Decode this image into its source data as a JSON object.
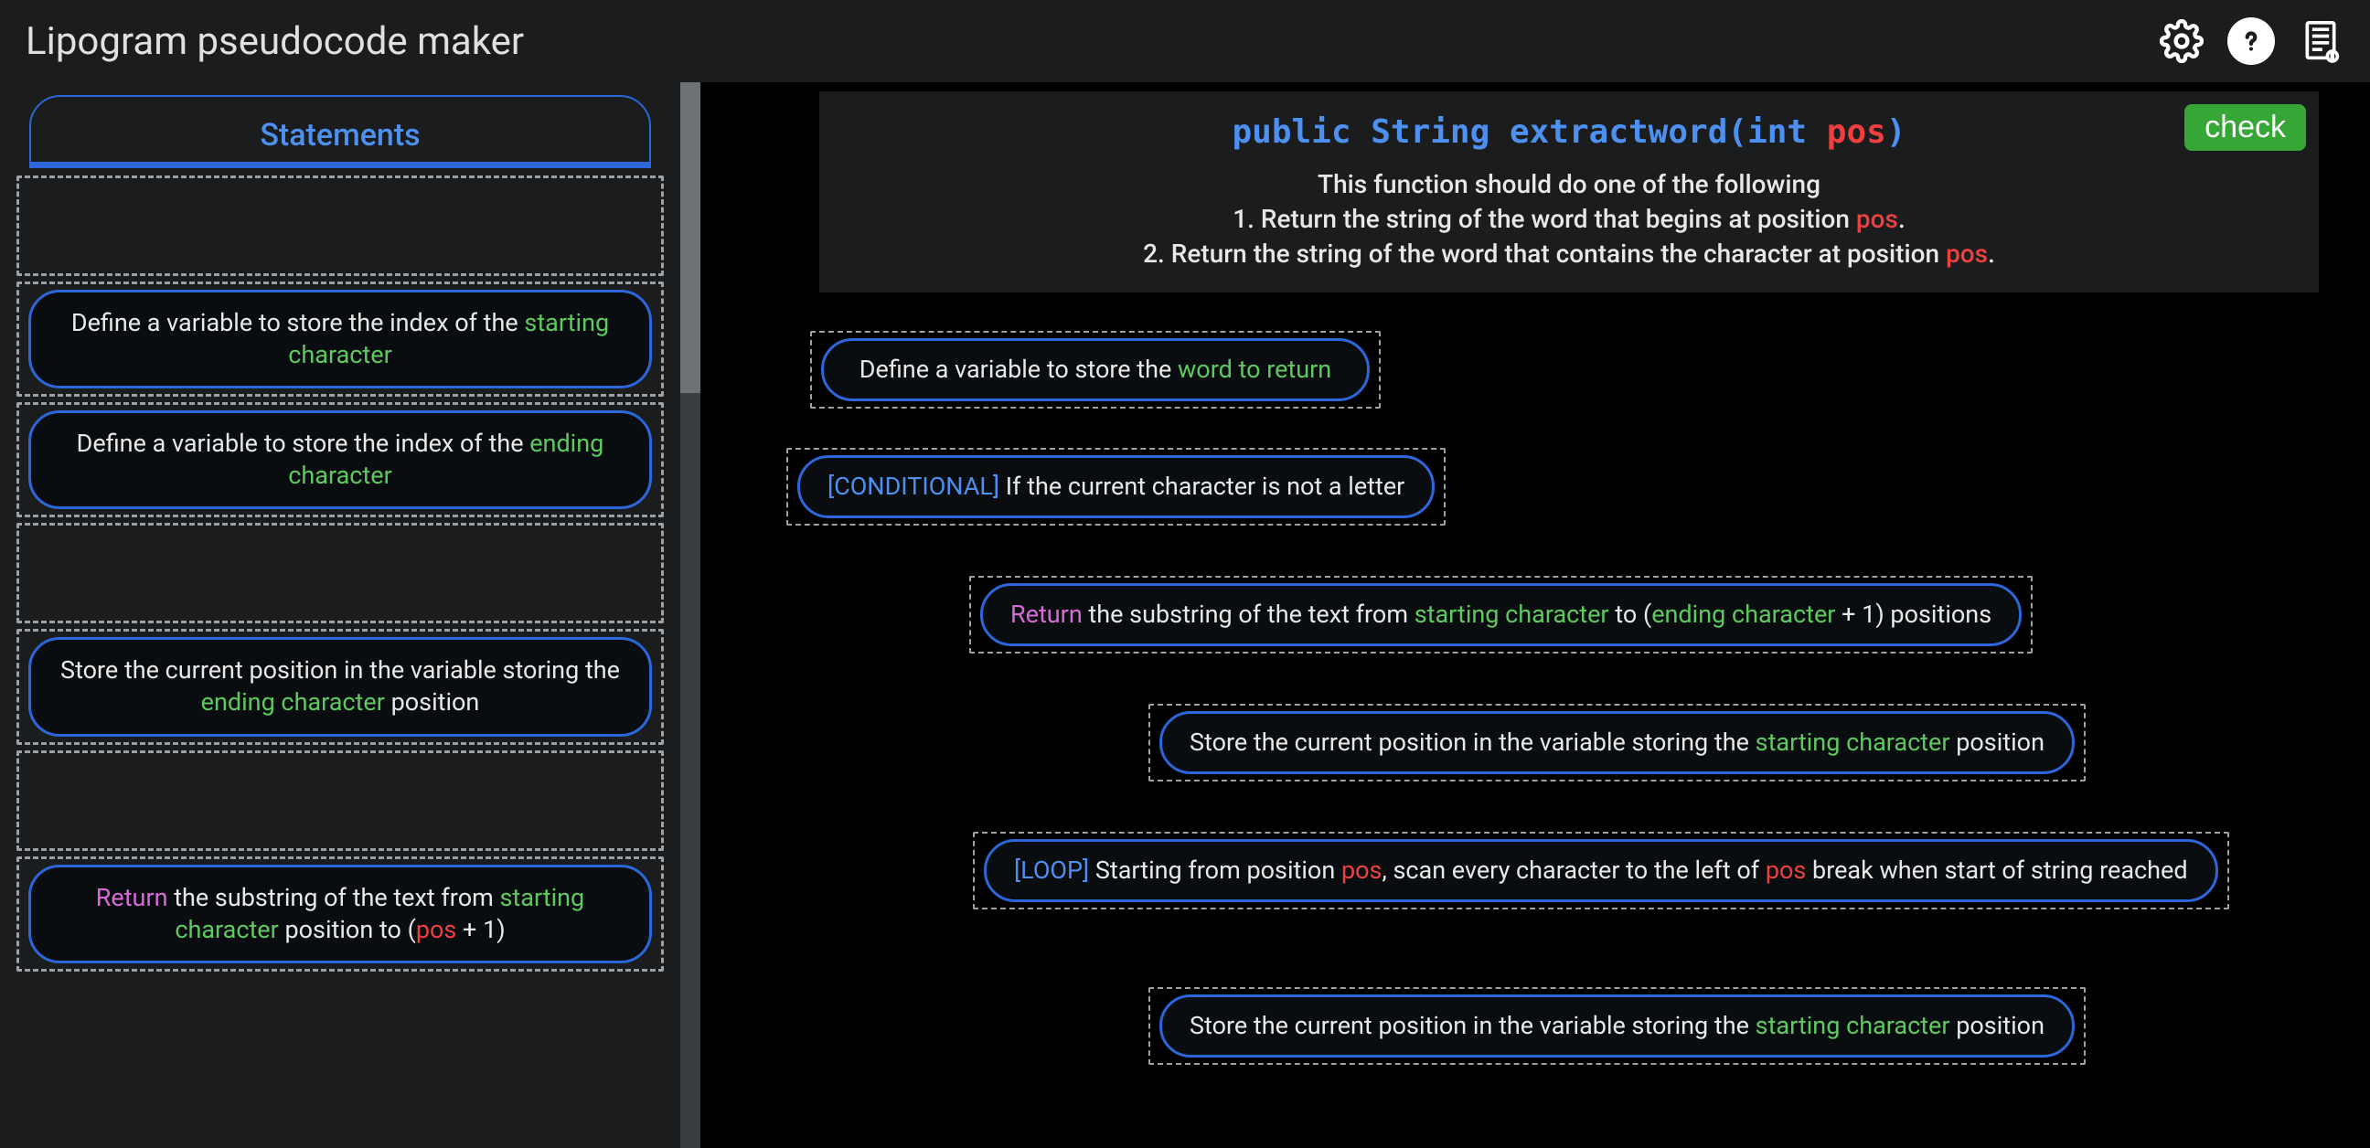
{
  "header": {
    "title": "Lipogram pseudocode maker"
  },
  "sidebar": {
    "tab_label": "Statements",
    "blocks": {
      "b1_pre": "Define a variable to store the index of the ",
      "b1_kw": "starting character",
      "b2_pre": "Define a variable to store the index of the ",
      "b2_kw": "ending character",
      "b3_pre": "Store the current position in the variable storing the ",
      "b3_kw": "ending character",
      "b3_post": " position",
      "b4_ret": "Return",
      "b4_mid1": " the substring of the text from ",
      "b4_kw1": "starting character",
      "b4_mid2": " position to (",
      "b4_kw2": "pos",
      "b4_post": " + 1)"
    }
  },
  "prompt": {
    "sig_public": "public",
    "sig_type": "String",
    "sig_name": "extractword",
    "sig_open": "(",
    "sig_argtype": "int",
    "sig_arg": "pos",
    "sig_close": ")",
    "line1": "This function should do one of the following",
    "line2_pre": "1. Return the string of the word that begins at position ",
    "line2_kw": "pos",
    "line2_post": ".",
    "line3_pre": "2. Return the string of the word that contains the character at position ",
    "line3_kw": "pos",
    "line3_post": ".",
    "check_label": "check"
  },
  "canvas": {
    "c1_pre": "Define a variable to store the ",
    "c1_kw": "word to return",
    "c2_tag": "[CONDITIONAL]",
    "c2_txt": " If the current character is not a letter",
    "c3_ret": "Return",
    "c3_mid1": " the substring of the text from ",
    "c3_kw1": "starting character",
    "c3_mid2": " to (",
    "c3_kw2": "ending character",
    "c3_post": " + 1) positions",
    "c4_pre": "Store the current position in the variable storing the ",
    "c4_kw": "starting character",
    "c4_post": " position",
    "c5_tag": "[LOOP]",
    "c5_mid1": " Starting from position ",
    "c5_kw1": "pos",
    "c5_mid2": ", scan every character to the left of ",
    "c5_kw2": "pos",
    "c5_post": " break when start of string reached",
    "c6_pre": "Store the current position in the variable storing the ",
    "c6_kw": "starting character",
    "c6_post": " position"
  }
}
